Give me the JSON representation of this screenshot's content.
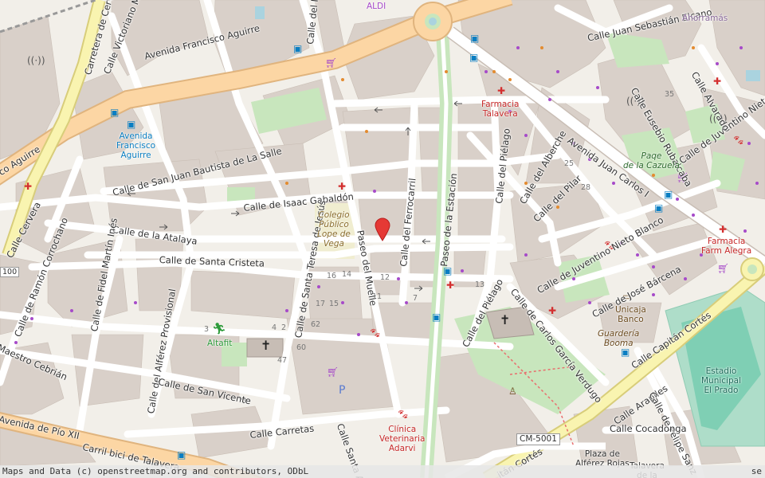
{
  "colors": {
    "land": "#f2efe9",
    "block": "#d9d0c9",
    "road": "#ffffff",
    "major": "#fcd6a4",
    "majorEdge": "#e0b47e",
    "trunk": "#f9f4b0",
    "green": "#c8e6bd",
    "park": "#cdebb0",
    "water": "#aad3df",
    "pharmacy": "#d32f2f",
    "transport": "#0a7ec2",
    "pin": "#e53935"
  },
  "streets": {
    "av_francisco_aguirre": "Avenida Francisco Aguirre",
    "co_aguirre": "co Aguirre",
    "san_juan_bautista": "Calle de San Juan Bautista de La Salle",
    "isaac_gabaldon": "Calle de Isaac Gabaldón",
    "atalaya": "Calle de la Atalaya",
    "santa_cristeta": "Calle de Santa Cristeta",
    "victoriano": "Calle Victoriano Medrano Paadín",
    "carretera_cervera": "Carretera de Cervera",
    "calle_cervera": "Calle Cervera",
    "ramon_corrochano": "Calle de Ramón Corrochano",
    "fidel_martin": "Calle de Fidel Martín Inés",
    "maestro_cebrian": "Maestro Cebrián",
    "alferez_provisional": "Calle del Alférez Provisional",
    "san_vicente": "Calle de San Vicente",
    "carretas": "Calle Carretas",
    "pio_xii": "Avenida de Pío XII",
    "carril_bici": "Carril bici de Talavera",
    "santa_teresa": "Calle de Santa Teresa de Jesús",
    "muelle_top": "Calle del Muelle",
    "paseo_muelle": "Paseo del Muelle",
    "ferrocarril": "Calle del Ferrocarril",
    "paseo_estacion": "Paseo de la Estación",
    "pielago_a": "Calle del Piélago",
    "pielago_b": "Calle del Piélago",
    "alberche": "Calle del Alberche",
    "pilar": "Calle del Pilar",
    "juan_carlos": "Avenida Juan Carlos I",
    "juventino_a": "Calle de Juventino Nieto Blanco",
    "juventino_b": "Calle de Juventino Nieto Bl",
    "jose_barcena": "Calle de José Bárcena",
    "carlos_garcia": "Calle de Carlos García Verdugo",
    "capitan_cortes": "Calle Capitán Cortés",
    "capitan_cortes_b": "itán Cortés",
    "arapiles": "Calle Arapiles",
    "felipe_sanz": "Calle de Felipe Sanz",
    "cocadonga": "Calle Cocadonga",
    "juan_sebastian": "Calle Juan Sebastián Elcano",
    "eusebio": "Calle Eusebio Rubalcaba",
    "alvarado": "Calle Alvarado",
    "santa_a": "Calle Santa A",
    "road_ref": "CM-5001"
  },
  "pois": {
    "aldi": "ALDI",
    "ahorramas": "Ahorramás",
    "farmacia_talavera": "Farmacia\nTalavera",
    "farmacia_farm_alegra": "Farmacia\nFarm Alegra",
    "parque_cazuela": "Paqe\nde la Cazuela",
    "colegio": "Colegio\nPúblico\nLope de\nVega",
    "bus_stop": "Avenida\nFrancisco\nAguirre",
    "altafit": "Altafit",
    "unicaja": "Unicaja\nBanco",
    "guarderia": "Guardería\nBooma",
    "estadio": "Estadio\nMunicipal\nEl Prado",
    "clinica": "Clínica\nVeterinaria\nAdarvi",
    "plaza": "Plaza de\nAlférez Rojas",
    "talavera_de": "Talavera\nde la",
    "parking": "P"
  },
  "house_numbers": [
    "35",
    "25",
    "28",
    "16",
    "14",
    "12",
    "17",
    "15",
    "11",
    "7",
    "13",
    "62",
    "60",
    "47",
    "3",
    "4",
    "2"
  ],
  "attribution": "Maps and Data (c) openstreetmap.org and contributors, ODbL",
  "attribution_right": "se"
}
